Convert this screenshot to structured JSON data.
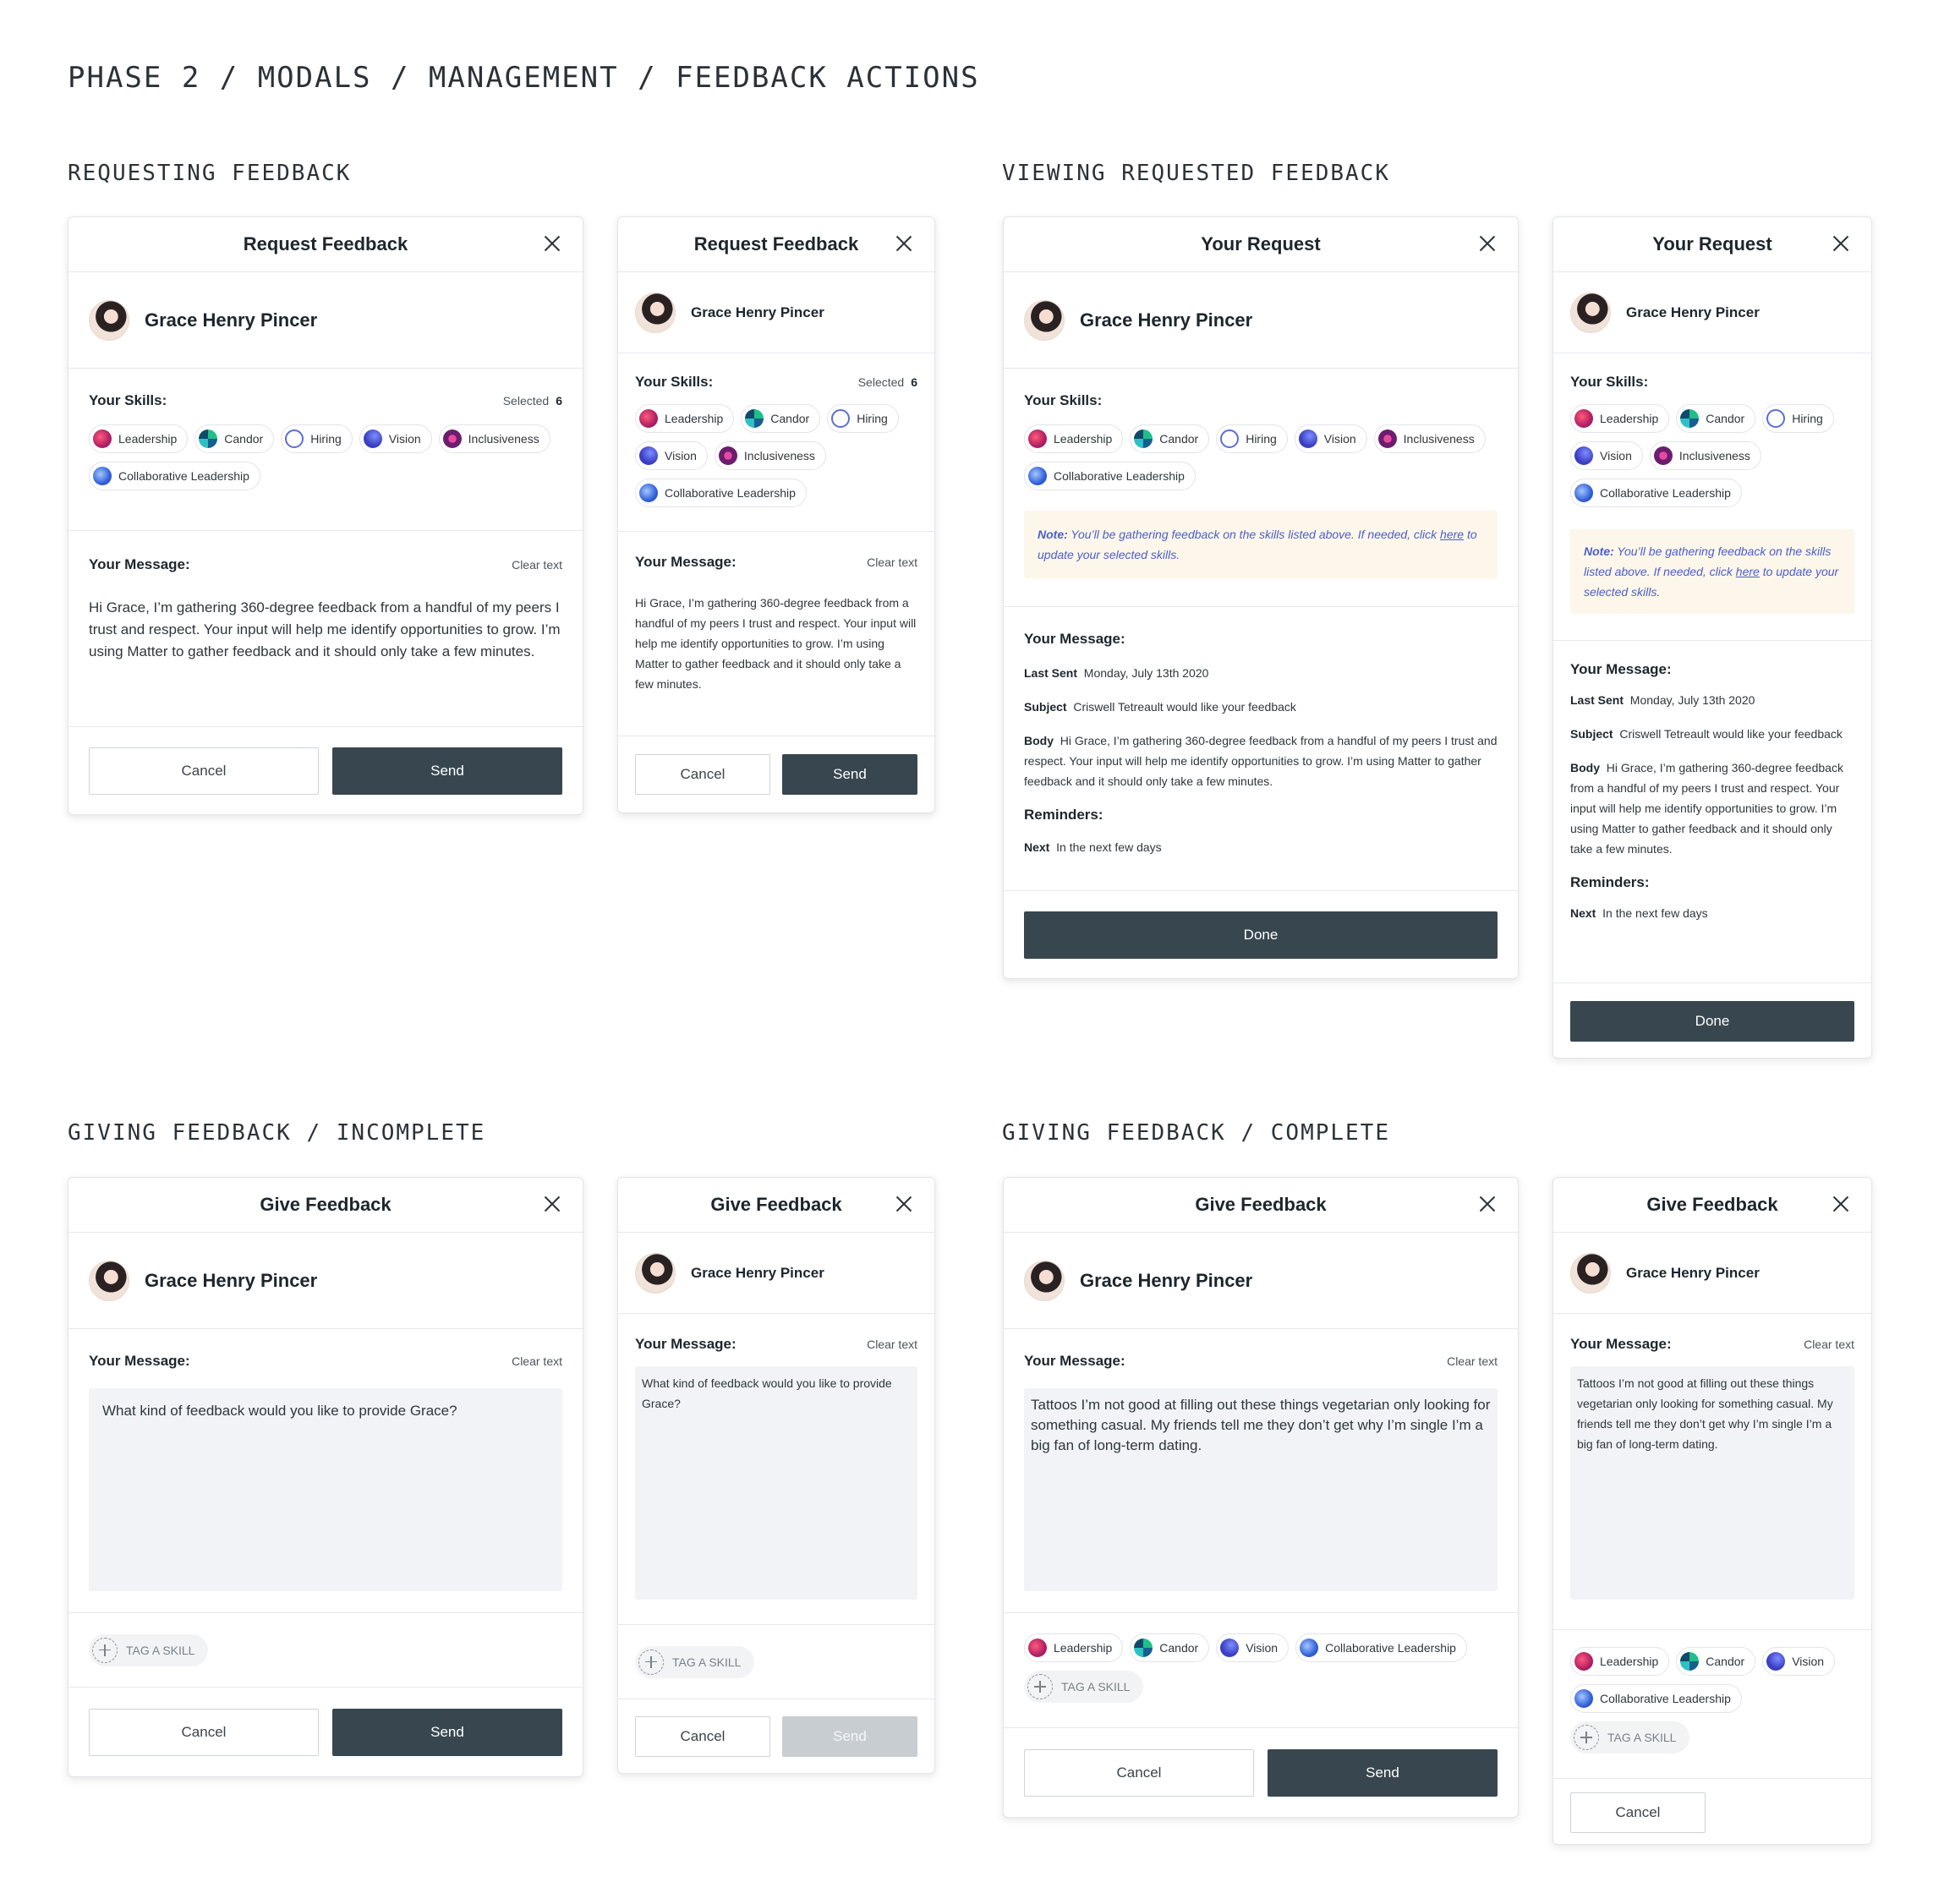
{
  "page_title": "PHASE 2 / MODALS / MANAGEMENT / FEEDBACK ACTIONS",
  "sections": {
    "requesting": "REQUESTING FEEDBACK",
    "viewing": "VIEWING REQUESTED FEEDBACK",
    "giving_incomplete": "GIVING FEEDBACK / INCOMPLETE",
    "giving_complete": "GIVING FEEDBACK / COMPLETE"
  },
  "common": {
    "close_icon": "close-icon",
    "user_name": "Grace Henry Pincer",
    "skills_label": "Your Skills:",
    "message_label": "Your Message:",
    "clear_text": "Clear text",
    "selected_label": "Selected",
    "selected_count": "6",
    "cancel": "Cancel",
    "send": "Send",
    "done": "Done",
    "tag_skill": "TAG A SKILL",
    "reminders_label": "Reminders:"
  },
  "titles": {
    "request": "Request Feedback",
    "your_request": "Your Request",
    "give": "Give Feedback"
  },
  "skills": {
    "leadership": "Leadership",
    "candor": "Candor",
    "hiring": "Hiring",
    "vision": "Vision",
    "inclusiveness": "Inclusiveness",
    "collaborative": "Collaborative Leadership"
  },
  "request_message": "Hi Grace, I’m gathering 360-degree feedback from a handful of my peers I trust and respect. Your input will help me identify opportunities to grow. I’m using Matter to gather feedback and it should only take a few minutes.",
  "note": {
    "label": "Note:",
    "text_before": "You’ll be gathering feedback on the skills listed above. If needed, click",
    "link": "here",
    "text_after": "to update your selected skills."
  },
  "sent": {
    "last_sent_label": "Last Sent",
    "last_sent_value": "Monday, July 13th 2020",
    "subject_label": "Subject",
    "subject_value": "Criswell Tetreault would like your feedback",
    "body_label": "Body",
    "body_value": "Hi Grace, I’m gathering 360-degree feedback from a handful of my peers I trust and respect. Your input will help me identify opportunities to grow. I’m using Matter to gather feedback and it should only take a few minutes.",
    "next_label": "Next",
    "next_value": "In the next few days"
  },
  "give": {
    "placeholder": "What kind of feedback would you like to provide Grace?",
    "complete_text": "Tattoos I’m not good at filling out these things vegetarian only looking for something casual. My friends tell me they don’t get why I’m single I’m a big fan of long-term dating."
  }
}
